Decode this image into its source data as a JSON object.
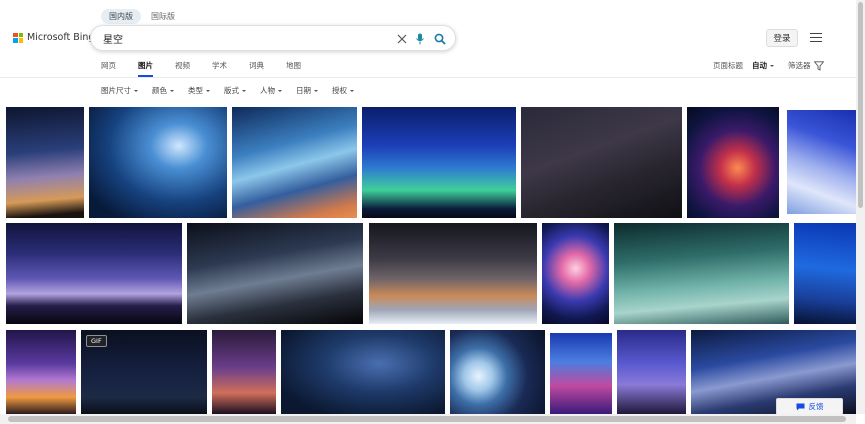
{
  "header": {
    "region_tabs": [
      "国内版",
      "国际版"
    ],
    "logo_text": "Microsoft Bing",
    "logo_colors": [
      "#f25022",
      "#7fba00",
      "#00a4ef",
      "#ffb900"
    ],
    "search_value": "星空",
    "login_label": "登录"
  },
  "nav": {
    "items": [
      "网页",
      "图片",
      "视频",
      "学术",
      "词典",
      "地图"
    ],
    "active": "图片"
  },
  "tools": {
    "page_title_label": "页面标题",
    "auto_label": "自动",
    "filter_label": "筛选器"
  },
  "filters": [
    "图片尺寸",
    "颜色",
    "类型",
    "版式",
    "人物",
    "日期",
    "授权"
  ],
  "images": {
    "gif_label": "GIF",
    "tile_icons": [
      "milky-way-image",
      "shooting-stars-image",
      "blue-nebula-image",
      "meteor-shower-image",
      "dark-starry-sky-image",
      "galaxy-nebula-image",
      "blue-clouds-image",
      "purple-mountains-image",
      "silhouettes-milky-way-image",
      "snowy-milky-way-image",
      "colorful-nebula-image",
      "teal-aurora-image",
      "blue-tree-night-image",
      "purple-sunset-image",
      "gif-starry-image",
      "purple-horizon-image",
      "dark-blue-nebula-image",
      "planet-space-image",
      "nebula-portrait-image",
      "purple-mountains-night-image",
      "milky-way-lake-image"
    ]
  },
  "feedback_label": "反馈",
  "accent_color": "#174ae4"
}
